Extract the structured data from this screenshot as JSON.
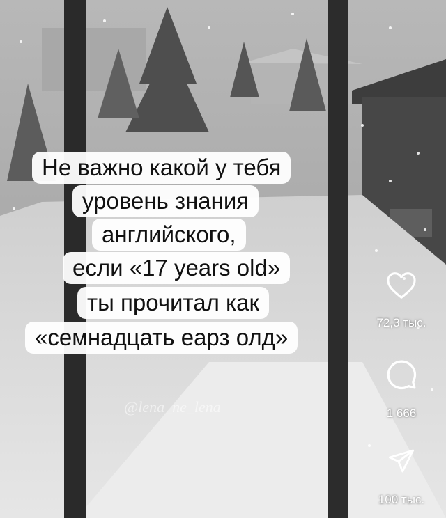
{
  "caption": {
    "lines": [
      "Не важно какой у тебя",
      "уровень знания",
      "английского,",
      "если «17 years old»",
      "ты прочитал как",
      "«семнадцать еарз олд»"
    ]
  },
  "watermark": "@lena_ne_lena",
  "actions": {
    "like": {
      "icon": "heart-icon",
      "count": "72,3 тыс."
    },
    "comment": {
      "icon": "comment-bubble-icon",
      "count": "1 666"
    },
    "share": {
      "icon": "paper-plane-icon",
      "count": "100 тыс."
    }
  },
  "colors": {
    "caption_bg": "#f4f4f4",
    "caption_text": "#111111",
    "icon": "#ffffff"
  }
}
